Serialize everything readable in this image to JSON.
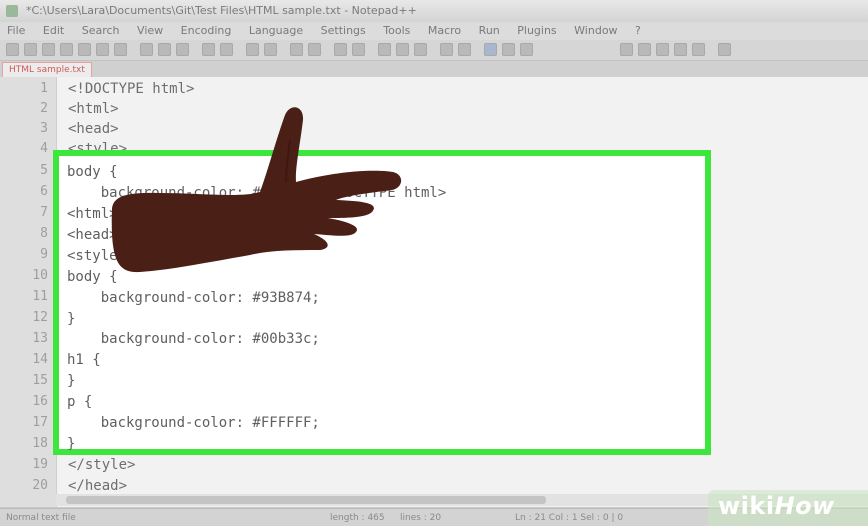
{
  "window": {
    "title": "*C:\\Users\\Lara\\Documents\\Git\\Test Files\\HTML sample.txt - Notepad++"
  },
  "menubar": {
    "items": [
      "File",
      "Edit",
      "Search",
      "View",
      "Encoding",
      "Language",
      "Settings",
      "Tools",
      "Macro",
      "Run",
      "Plugins",
      "Window",
      "?"
    ]
  },
  "tab": {
    "label": "HTML sample.txt"
  },
  "editor": {
    "line_numbers": [
      "1",
      "2",
      "3",
      "4",
      "5",
      "6",
      "7",
      "8",
      "9",
      "10",
      "11",
      "12",
      "13",
      "14",
      "15",
      "16",
      "17",
      "18",
      "19",
      "20"
    ],
    "lines": [
      "<!DOCTYPE html>",
      "<html>",
      "<head>",
      "<style>",
      "body {",
      "    background-color: #8a4dff;<!DOCTYPE html>",
      "<html>",
      "<head>",
      "<style>",
      "body {",
      "    background-color: #93B874;",
      "}",
      "h1 {",
      "    background-color: #00b33c;",
      "}",
      "p {",
      "    background-color: #FFFFFF;",
      "}",
      "</style>",
      "</head>"
    ]
  },
  "statusbar": {
    "file_type": "Normal text file",
    "length": "length : 465",
    "lines": "lines : 20",
    "position": "Ln : 21   Col : 1   Sel : 0 | 0"
  },
  "watermark": {
    "wiki": "wiki",
    "how": "How"
  },
  "colors": {
    "highlight_border": "#3ce63c",
    "hand": "#4a1f16"
  }
}
